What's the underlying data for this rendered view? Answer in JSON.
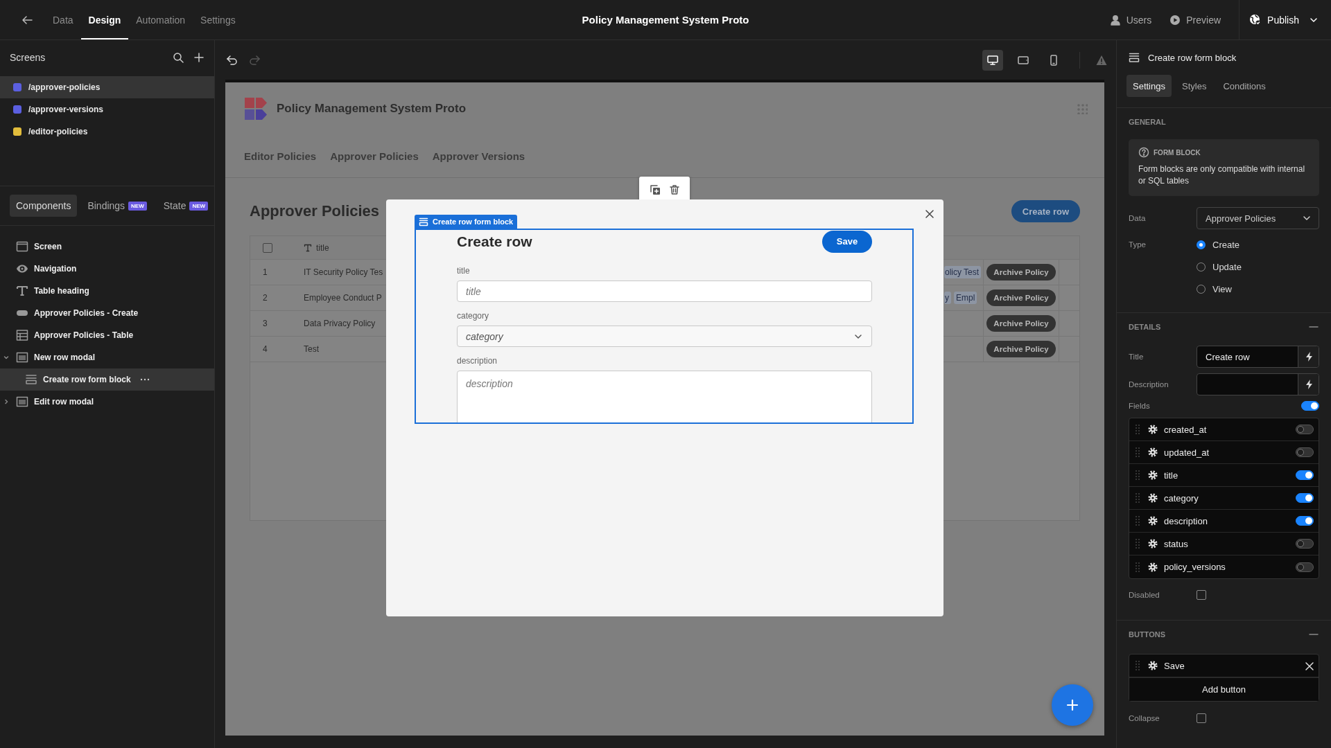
{
  "top_bar": {
    "tabs": [
      {
        "label": "Data",
        "selected": false
      },
      {
        "label": "Design",
        "selected": true
      },
      {
        "label": "Automation",
        "selected": false
      },
      {
        "label": "Settings",
        "selected": false
      }
    ],
    "title": "Policy Management System Proto",
    "actions": [
      {
        "label": "Users",
        "kind": "users"
      },
      {
        "label": "Preview",
        "kind": "preview"
      }
    ],
    "publish": "Publish"
  },
  "screens_panel": {
    "title": "Screens",
    "screens": [
      {
        "path": "/approver-policies",
        "color": "#5b5fe0",
        "selected": true
      },
      {
        "path": "/approver-versions",
        "color": "#5b5fe0",
        "selected": false
      },
      {
        "path": "/editor-policies",
        "color": "#e2bd3c",
        "selected": false
      }
    ]
  },
  "component_tabs": [
    {
      "label": "Components",
      "selected": true
    },
    {
      "label": "Bindings",
      "badge": "NEW",
      "selected": false
    },
    {
      "label": "State",
      "badge": "NEW",
      "selected": false
    }
  ],
  "component_tree": [
    {
      "label": "Screen",
      "kind": "screen",
      "selected": false
    },
    {
      "label": "Navigation",
      "kind": "navigation",
      "selected": false
    },
    {
      "label": "Table heading",
      "kind": "heading",
      "selected": false
    },
    {
      "label": "Approver Policies - Create",
      "kind": "button",
      "selected": false
    },
    {
      "label": "Approver Policies - Table",
      "kind": "table",
      "selected": false
    },
    {
      "label": "New row modal",
      "kind": "modal",
      "expanded": true,
      "selected": false,
      "children": [
        {
          "label": "Create row form block",
          "kind": "form",
          "selected": true
        }
      ]
    },
    {
      "label": "Edit row modal",
      "kind": "modal",
      "expanded": false,
      "selected": false
    }
  ],
  "canvas_toolbar": {
    "history": [
      {
        "kind": "undo",
        "disabled": false
      },
      {
        "kind": "redo",
        "disabled": true
      }
    ],
    "devices": [
      {
        "kind": "desktop",
        "selected": true
      },
      {
        "kind": "tablet",
        "selected": false
      },
      {
        "kind": "phone",
        "selected": false
      }
    ]
  },
  "preview": {
    "app_title": "Policy Management System Proto",
    "nav": [
      "Editor Policies",
      "Approver Policies",
      "Approver Versions"
    ],
    "heading": "Approver Policies",
    "create_button": "Create row",
    "table": {
      "select_all": false,
      "columns": [
        {
          "label": "title",
          "kind": "text"
        }
      ],
      "rows": [
        {
          "index": "1",
          "title": "IT Security Policy Tes",
          "column_3": [
            "olicy Test"
          ],
          "action": "Archive Policy"
        },
        {
          "index": "2",
          "title": "Employee Conduct P",
          "column_3": [
            "y",
            "Empl"
          ],
          "action": "Archive Policy"
        },
        {
          "index": "3",
          "title": "Data Privacy Policy",
          "action": "Archive Policy"
        },
        {
          "index": "4",
          "title": "Test",
          "action": "Archive Policy"
        }
      ]
    }
  },
  "modal": {
    "block_label": "Create row form block",
    "title": "Create row",
    "save": "Save",
    "fields": [
      {
        "label": "title",
        "kind": "text",
        "placeholder": "title"
      },
      {
        "label": "category",
        "kind": "select",
        "placeholder": "category"
      },
      {
        "label": "description",
        "kind": "textarea",
        "placeholder": "description"
      }
    ]
  },
  "settings_panel": {
    "title": "Create row form block",
    "tabs": [
      {
        "label": "Settings",
        "selected": true
      },
      {
        "label": "Styles",
        "selected": false
      },
      {
        "label": "Conditions",
        "selected": false
      }
    ],
    "general": {
      "heading": "GENERAL",
      "info_title": "FORM BLOCK",
      "info_text": "Form blocks are only compatible with internal or SQL tables",
      "data_label": "Data",
      "data_value": "Approver Policies",
      "type_label": "Type",
      "types": [
        {
          "label": "Create",
          "selected": true
        },
        {
          "label": "Update",
          "selected": false
        },
        {
          "label": "View",
          "selected": false
        }
      ]
    },
    "details": {
      "heading": "DETAILS",
      "title_label": "Title",
      "title_value": "Create row",
      "description_label": "Description",
      "fields_label": "Fields",
      "fields_on": true,
      "fields": [
        {
          "name": "created_at",
          "on": false
        },
        {
          "name": "updated_at",
          "on": false
        },
        {
          "name": "title",
          "on": true
        },
        {
          "name": "category",
          "on": true
        },
        {
          "name": "description",
          "on": true
        },
        {
          "name": "status",
          "on": false
        },
        {
          "name": "policy_versions",
          "on": false
        }
      ],
      "disabled_label": "Disabled",
      "disabled": false
    },
    "buttons": {
      "heading": "BUTTONS",
      "items": [
        "Save"
      ],
      "add_label": "Add button",
      "collapse_label": "Collapse",
      "collapse": false
    }
  }
}
